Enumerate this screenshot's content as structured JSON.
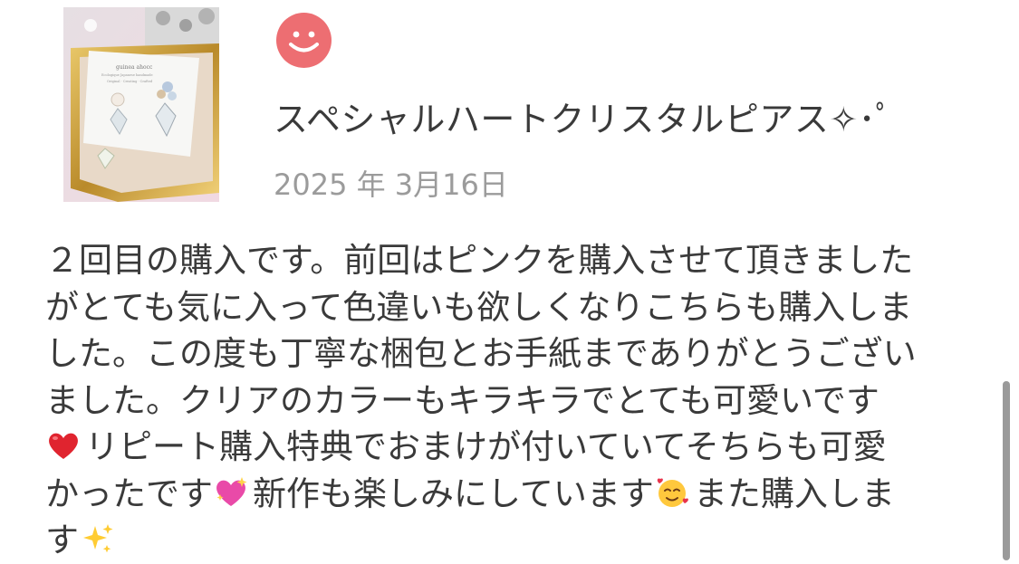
{
  "product": {
    "image_icon": "earring-product-photo",
    "image_text": {
      "card_brand": "guinea ahocc",
      "card_line1": "Ecologique Japanese handmade",
      "card_line2": "Original · Creating · Crafted"
    },
    "title": "スペシャルハートクリスタルピアス✧･ﾟ"
  },
  "reviewer": {
    "avatar_icon": "smiley-face-icon",
    "avatar_color": "#ed6e72"
  },
  "review": {
    "date": "2025 年 3月16日",
    "lines": [
      {
        "text": "２回目の購入です。前回はピンクを購入させて頂きました"
      },
      {
        "text": "がとても気に入って色違いも欲しくなりこちらも購入しま"
      },
      {
        "text": "した。この度も丁寧な梱包とお手紙までありがとうござい"
      },
      {
        "text": "ました。クリアのカラーもキラキラでとても可愛いです"
      },
      {
        "emoji_start": "red-heart-emoji",
        "text": "リピート購入特典でおまけが付いていてそちらも可愛"
      },
      {
        "part1": "かったです",
        "emoji1": "sparkling-heart-emoji",
        "part2": "新作も楽しみにしています",
        "emoji2": "smiling-face-with-hearts-emoji",
        "part3": "また購入しま"
      },
      {
        "text": "す",
        "emoji_end": "sparkles-emoji"
      }
    ]
  },
  "scrollbar": {
    "icon": "vertical-scrollbar"
  }
}
